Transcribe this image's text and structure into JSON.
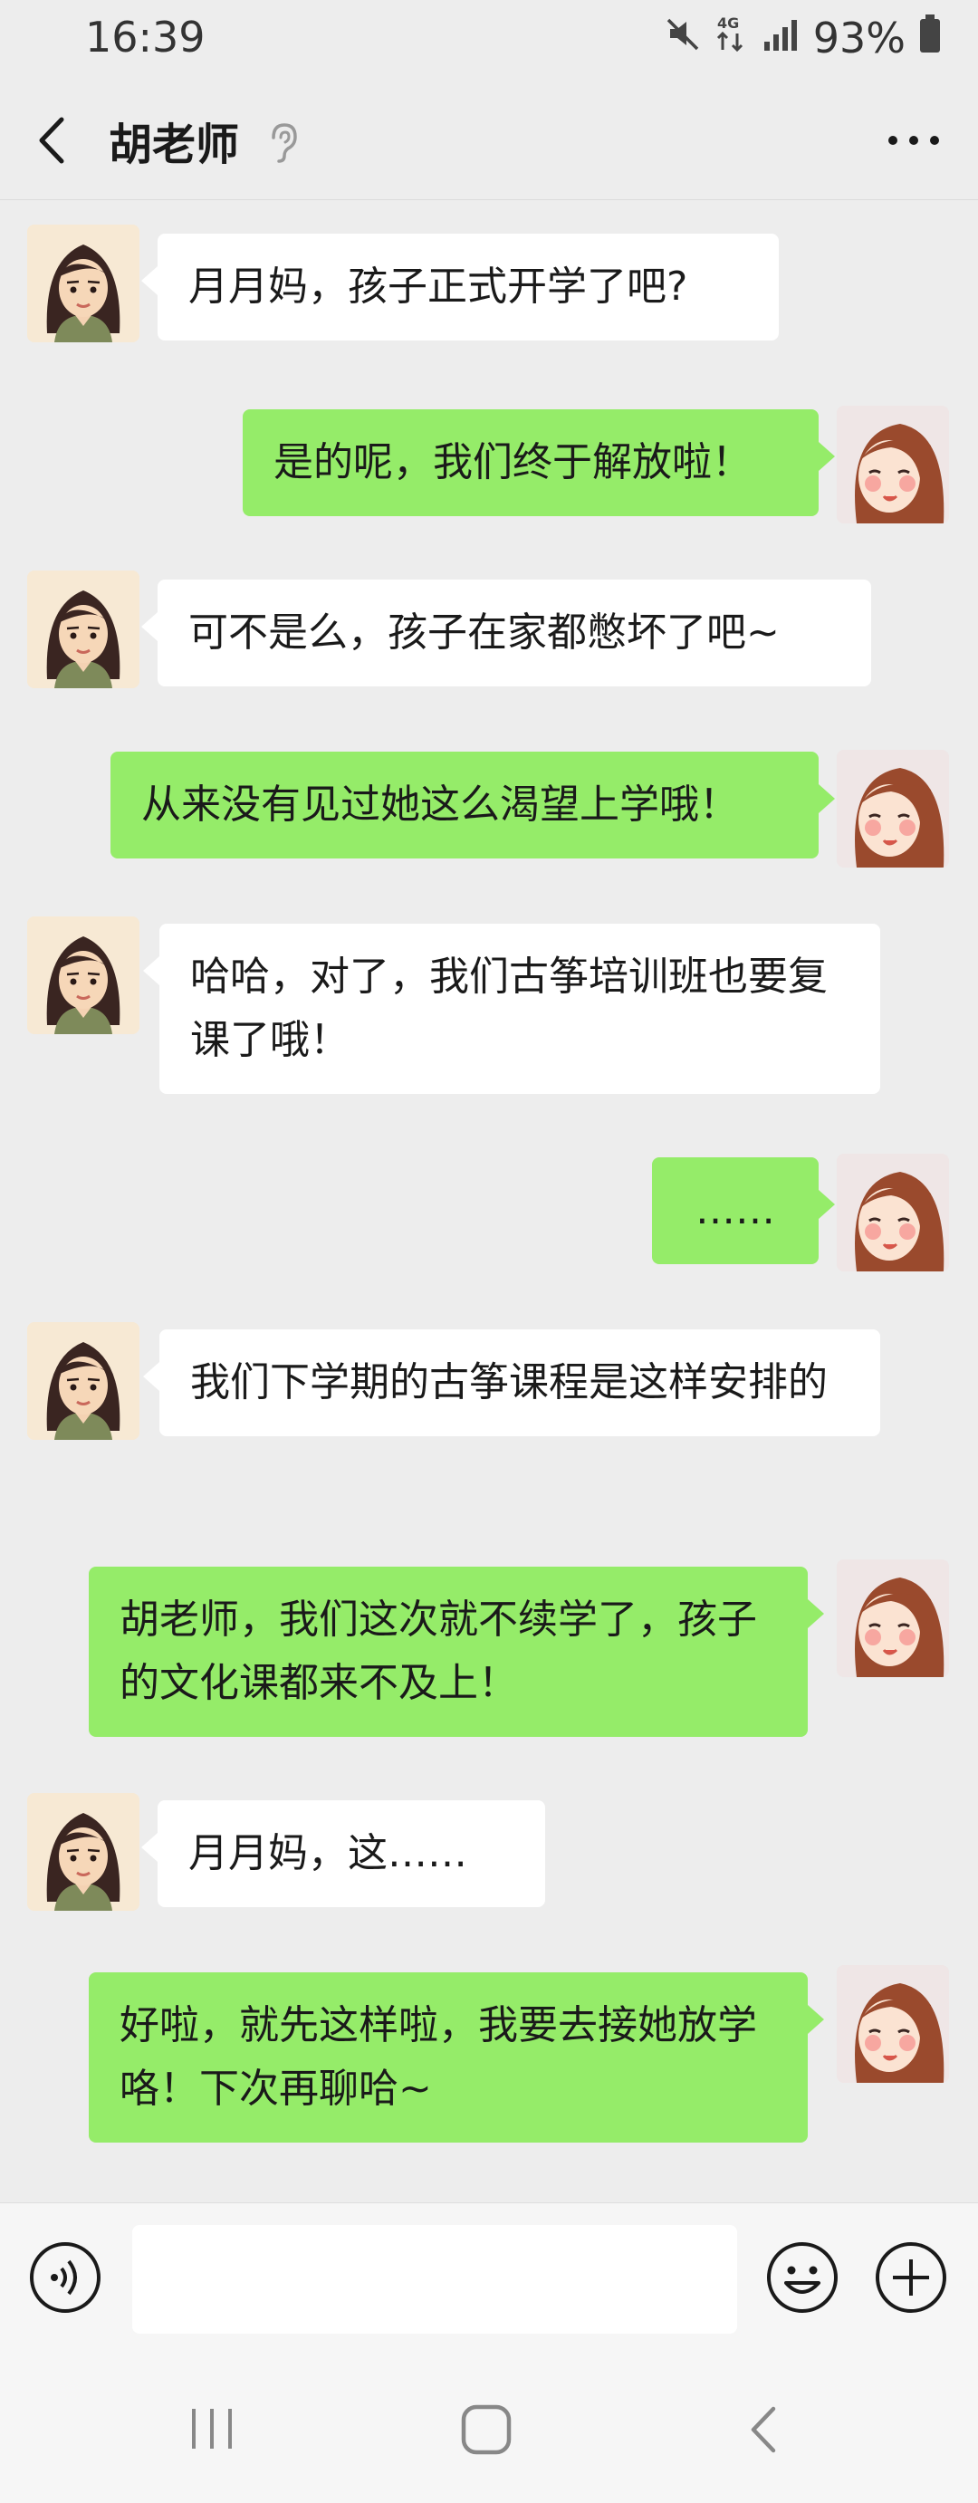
{
  "status_bar": {
    "time": "16:39",
    "network": "4G",
    "battery": "93%",
    "icons": [
      "mute-icon",
      "4g-data-icon",
      "signal-icon",
      "battery-icon"
    ]
  },
  "header": {
    "title": "胡老师",
    "icons": [
      "back-icon",
      "ear-icon",
      "more-icon"
    ]
  },
  "messages": [
    {
      "from": "teacher",
      "text": "月月妈，孩子正式开学了吧?"
    },
    {
      "from": "me",
      "text": "是的呢，我们终于解放啦！"
    },
    {
      "from": "teacher",
      "text": "可不是么，孩子在家都憋坏了吧~"
    },
    {
      "from": "me",
      "text": "从来没有见过她这么渴望上学哦！"
    },
    {
      "from": "teacher",
      "text": "哈哈，对了，我们古筝培训班也要复课了哦！"
    },
    {
      "from": "me",
      "text": "……"
    },
    {
      "from": "teacher",
      "text": "我们下学期的古筝课程是这样安排的"
    },
    {
      "from": "me",
      "text": "胡老师，我们这次就不续学了，孩子的文化课都来不及上！"
    },
    {
      "from": "teacher",
      "text": "月月妈，这……"
    },
    {
      "from": "me",
      "text": "好啦，就先这样啦，我要去接她放学咯！下次再聊哈~"
    }
  ],
  "input_bar": {
    "placeholder": "",
    "icons": [
      "voice-icon",
      "emoji-icon",
      "plus-icon"
    ]
  },
  "colors": {
    "background": "#ededed",
    "bubble_in": "#ffffff",
    "bubble_out": "#95ec69"
  }
}
